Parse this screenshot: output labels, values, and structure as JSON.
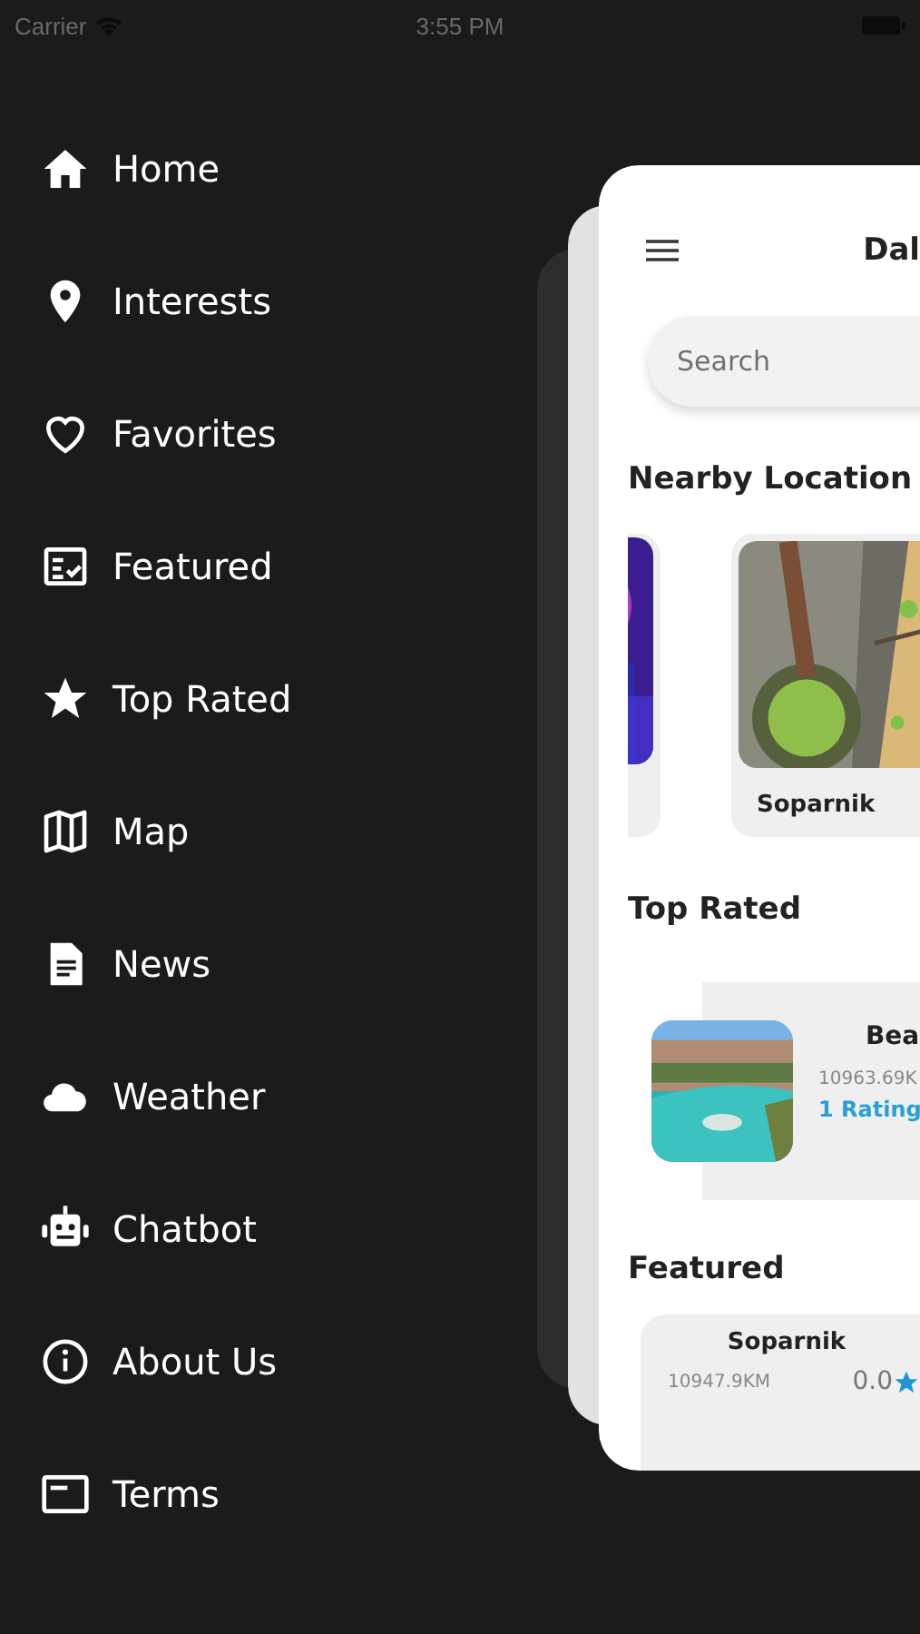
{
  "status_bar": {
    "carrier": "Carrier",
    "time": "3:55 PM"
  },
  "menu": [
    {
      "label": "Home"
    },
    {
      "label": "Interests"
    },
    {
      "label": "Favorites"
    },
    {
      "label": "Featured"
    },
    {
      "label": "Top Rated"
    },
    {
      "label": "Map"
    },
    {
      "label": "News"
    },
    {
      "label": "Weather"
    },
    {
      "label": "Chatbot"
    },
    {
      "label": "About Us"
    },
    {
      "label": "Terms"
    }
  ],
  "screen": {
    "title": "Dal",
    "search": {
      "placeholder": "Search"
    },
    "nearby": {
      "title": "Nearby Location",
      "cards": [
        {
          "kind": "partial"
        },
        {
          "kind": "full",
          "name": "Soparnik"
        }
      ]
    },
    "top_rated": {
      "title": "Top Rated",
      "cards": [
        {
          "name": "Bea",
          "distance": "10963.69K",
          "ratings": "1 Rating"
        }
      ]
    },
    "featured": {
      "title": "Featured",
      "cards": [
        {
          "name": "Soparnik",
          "distance": "10947.9KM",
          "rating": "0.0"
        }
      ]
    }
  }
}
